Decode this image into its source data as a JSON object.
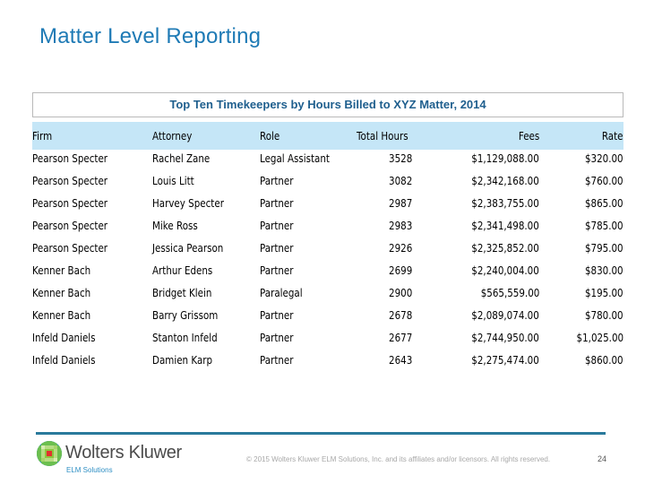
{
  "slide": {
    "title": "Matter Level Reporting",
    "page_number": "24"
  },
  "table": {
    "caption": "Top Ten Timekeepers by Hours Billed to XYZ Matter, 2014",
    "columns": [
      "Firm",
      "Attorney",
      "Role",
      "Total Hours",
      "Fees",
      "Rate"
    ],
    "rows": [
      {
        "firm": "Pearson Specter",
        "attorney": "Rachel Zane",
        "role": "Legal Assistant",
        "hours": "3528",
        "fees": "$1,129,088.00",
        "rate": "$320.00"
      },
      {
        "firm": "Pearson Specter",
        "attorney": "Louis Litt",
        "role": "Partner",
        "hours": "3082",
        "fees": "$2,342,168.00",
        "rate": "$760.00"
      },
      {
        "firm": "Pearson Specter",
        "attorney": "Harvey Specter",
        "role": "Partner",
        "hours": "2987",
        "fees": "$2,383,755.00",
        "rate": "$865.00"
      },
      {
        "firm": "Pearson Specter",
        "attorney": "Mike Ross",
        "role": "Partner",
        "hours": "2983",
        "fees": "$2,341,498.00",
        "rate": "$785.00"
      },
      {
        "firm": "Pearson Specter",
        "attorney": "Jessica Pearson",
        "role": "Partner",
        "hours": "2926",
        "fees": "$2,325,852.00",
        "rate": "$795.00"
      },
      {
        "firm": "Kenner Bach",
        "attorney": "Arthur Edens",
        "role": "Partner",
        "hours": "2699",
        "fees": "$2,240,004.00",
        "rate": "$830.00"
      },
      {
        "firm": "Kenner Bach",
        "attorney": "Bridget Klein",
        "role": "Paralegal",
        "hours": "2900",
        "fees": "$565,559.00",
        "rate": "$195.00"
      },
      {
        "firm": "Kenner Bach",
        "attorney": "Barry Grissom",
        "role": "Partner",
        "hours": "2678",
        "fees": "$2,089,074.00",
        "rate": "$780.00"
      },
      {
        "firm": "Infeld Daniels",
        "attorney": "Stanton Infeld",
        "role": "Partner",
        "hours": "2677",
        "fees": "$2,744,950.00",
        "rate": "$1,025.00"
      },
      {
        "firm": "Infeld Daniels",
        "attorney": "Damien Karp",
        "role": "Partner",
        "hours": "2643",
        "fees": "$2,275,474.00",
        "rate": "$860.00"
      }
    ]
  },
  "footer": {
    "brand_name": "Wolters Kluwer",
    "brand_sub": "ELM Solutions",
    "logo_icon": "wolters-kluwer-globe-icon",
    "copyright": "© 2015 Wolters Kluwer ELM Solutions, Inc. and its affiliates and/or licensors. All rights reserved."
  },
  "colors": {
    "title": "#1e7ab5",
    "caption": "#1f5f8e",
    "header_bg": "#c5e6f7",
    "footer_rule": "#2a7a9c"
  }
}
